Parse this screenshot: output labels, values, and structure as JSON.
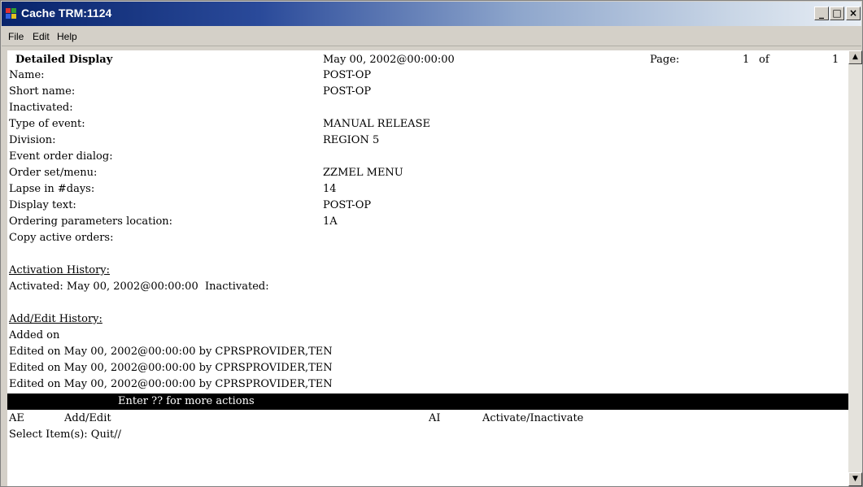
{
  "window": {
    "title": "Cache TRM:1124",
    "minimize_glyph": "_",
    "maximize_glyph": "□",
    "close_glyph": "×",
    "icon": "cache-app-icon"
  },
  "menu": [
    "File",
    "Edit",
    "Help"
  ],
  "header": {
    "title": "Detailed Display",
    "date": "May 00, 2002@00:00:00",
    "page_label": "Page:",
    "page_current": "1",
    "page_of": "of",
    "page_total": "1"
  },
  "fields": [
    {
      "label": "Name:",
      "value": "POST-OP"
    },
    {
      "label": "Short name:",
      "value": "POST-OP"
    },
    {
      "label": "Inactivated:",
      "value": ""
    },
    {
      "label": "Type of event:",
      "value": "MANUAL RELEASE"
    },
    {
      "label": "Division:",
      "value": "REGION 5"
    },
    {
      "label": "Event order dialog:",
      "value": ""
    },
    {
      "label": "Order set/menu:",
      "value": "ZZMEL MENU"
    },
    {
      "label": "Lapse in #days:",
      "value": "14"
    },
    {
      "label": "Display text:",
      "value": "POST-OP"
    },
    {
      "label": "Ordering parameters location:",
      "value": "1A"
    },
    {
      "label": "Copy active orders:",
      "value": ""
    }
  ],
  "activation": {
    "heading": "Activation History:",
    "line": "Activated: May 00, 2002@00:00:00  Inactivated:"
  },
  "edit_history": {
    "heading": "Add/Edit History:",
    "lines": [
      "Added on",
      "Edited on May 00, 2002@00:00:00 by CPRSPROVIDER,TEN",
      "Edited on May 00, 2002@00:00:00 by CPRSPROVIDER,TEN",
      "Edited on May 00, 2002@00:00:00 by CPRSPROVIDER,TEN"
    ]
  },
  "status_bar": "Enter ?? for more actions",
  "actions": [
    {
      "code": "AE",
      "label": "Add/Edit"
    },
    {
      "code": "AI",
      "label": "Activate/Inactivate"
    }
  ],
  "prompt": "Select Item(s): Quit//",
  "scroll_up_glyph": "▲",
  "scroll_down_glyph": "▼",
  "colors": {
    "titlebar_start": "#08246b",
    "status_bar_bg": "#000000",
    "terminal_bg": "#ffffff"
  }
}
